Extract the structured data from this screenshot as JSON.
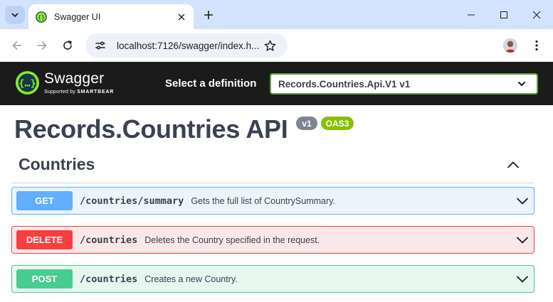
{
  "browser": {
    "tab_title": "Swagger UI",
    "url": "localhost:7126/swagger/index.h...",
    "icons": {
      "tab_search": "chevron-down-icon",
      "favicon": "swagger-favicon-icon",
      "tab_close": "close-icon",
      "new_tab": "plus-icon",
      "minimize": "minimize-icon",
      "maximize": "maximize-icon",
      "close": "close-icon",
      "back": "arrow-left-icon",
      "forward": "arrow-right-icon",
      "reload": "reload-icon",
      "site_info": "tune-icon",
      "bookmark": "star-icon",
      "menu": "more-vertical-icon"
    }
  },
  "topbar": {
    "logo_name": "Swagger",
    "logo_sub_prefix": "Supported by",
    "logo_sub_brand": "SMARTBEAR",
    "definition_label": "Select a definition",
    "definition_selected": "Records.Countries.Api.V1 v1",
    "background": "#1b1b1b",
    "logo_color": "#85ea2d"
  },
  "info": {
    "title": "Records.Countries API",
    "version_badge": "v1",
    "oas_badge": "OAS3"
  },
  "tag": {
    "name": "Countries"
  },
  "operations": [
    {
      "method": "GET",
      "path": "/countries/summary",
      "summary": "Gets the full list of CountrySummary.",
      "color": "#61affe"
    },
    {
      "method": "DELETE",
      "path": "/countries",
      "summary": "Deletes the Country specified in the request.",
      "color": "#f93e3e"
    },
    {
      "method": "POST",
      "path": "/countries",
      "summary": "Creates a new Country.",
      "color": "#49cc90"
    }
  ]
}
